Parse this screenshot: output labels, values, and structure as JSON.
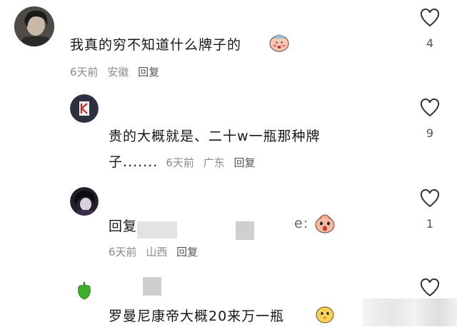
{
  "comments": [
    {
      "text": "我真的穷不知道什么牌子的",
      "time": "6天前",
      "location": "安徽",
      "reply_label": "回复",
      "likes": "4",
      "avatar": "person-photo-avatar"
    },
    {
      "text_line1": "贵的大概就是、二十w一瓶那种牌",
      "text_line2": "子.......",
      "time": "6天前",
      "location": "广东",
      "reply_label": "回复",
      "likes": "9",
      "avatar": "letter-k-logo-avatar"
    },
    {
      "text_prefix": "回复",
      "text_suffix": "e:",
      "time": "6天前",
      "location": "山西",
      "reply_label": "回复",
      "likes": "1",
      "avatar": "dark-anime-avatar"
    },
    {
      "text": "罗曼尼康帝大概20来万一瓶",
      "avatar": "green-pepper-icon"
    }
  ],
  "colors": {
    "text": "#161616",
    "meta": "#8a8a8a",
    "heart": "#333333"
  }
}
